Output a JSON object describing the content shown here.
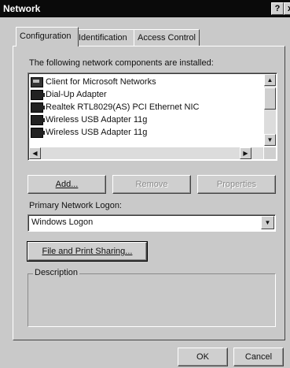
{
  "window": {
    "title": "Network",
    "help_glyph": "?",
    "close_glyph": "x"
  },
  "tabs": [
    {
      "label": "Configuration",
      "active": true
    },
    {
      "label": "Identification",
      "active": false
    },
    {
      "label": "Access Control",
      "active": false
    }
  ],
  "components": {
    "caption": "The following network components are installed:",
    "items": [
      {
        "label": "Client for Microsoft Networks",
        "icon": "network-client-icon"
      },
      {
        "label": "Dial-Up Adapter",
        "icon": "adapter-icon"
      },
      {
        "label": "Realtek RTL8029(AS) PCI Ethernet NIC",
        "icon": "adapter-icon"
      },
      {
        "label": "Wireless USB Adapter 11g",
        "icon": "adapter-icon"
      },
      {
        "label": "Wireless USB Adapter 11g",
        "icon": "adapter-icon"
      }
    ]
  },
  "buttons": {
    "add": "Add...",
    "remove": "Remove",
    "properties": "Properties",
    "file_print": "File and Print Sharing...",
    "ok": "OK",
    "cancel": "Cancel"
  },
  "logon": {
    "label": "Primary Network Logon:",
    "value": "Windows Logon"
  },
  "description": {
    "label": "Description"
  }
}
